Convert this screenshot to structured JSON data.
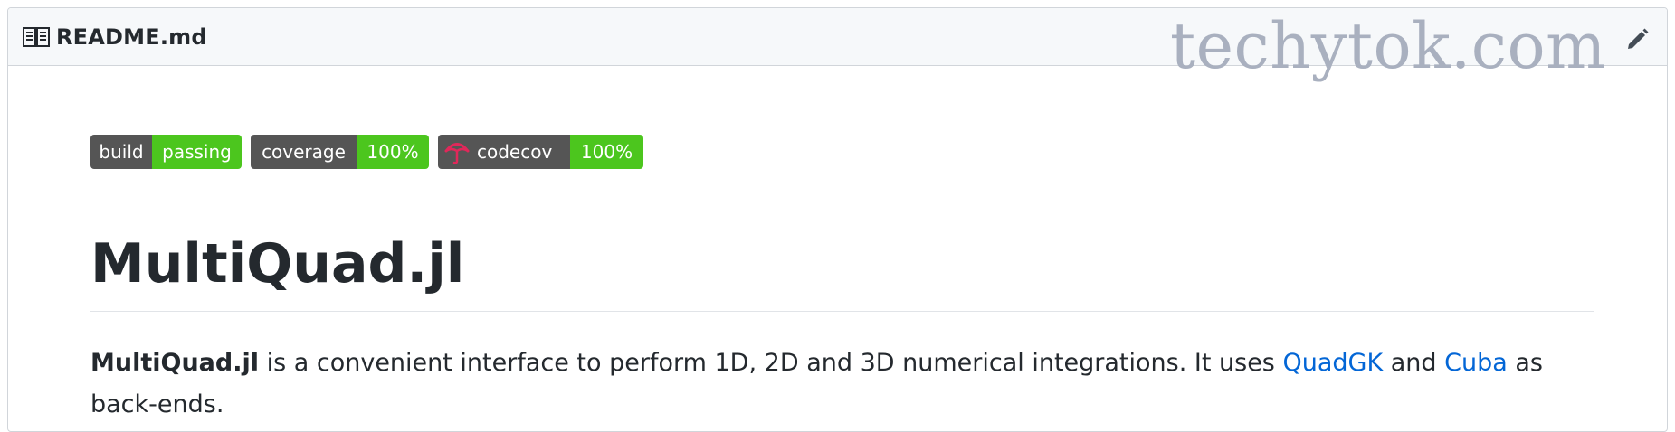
{
  "header": {
    "file_name": "README.md",
    "icons": {
      "file": "book-icon",
      "edit": "pencil-icon"
    }
  },
  "watermark": "techytok.com",
  "badges": [
    {
      "label": "build",
      "value": "passing"
    },
    {
      "label": "coverage",
      "value": "100%"
    },
    {
      "label": "codecov",
      "value": "100%",
      "icon": "codecov-umbrella-icon"
    }
  ],
  "readme": {
    "title": "MultiQuad.jl",
    "intro": {
      "name_bold": "MultiQuad.jl",
      "text_before_links": " is a convenient interface to perform 1D, 2D and 3D numerical integrations. It uses ",
      "link_quadgk": "QuadGK",
      "between_links": " and ",
      "link_cuba": "Cuba",
      "after_links": " as back-ends."
    }
  },
  "colors": {
    "badge_left": "#555555",
    "badge_right": "#4cc61e",
    "link": "#0366d6",
    "watermark": "#a9b0bf",
    "codecov_logo": "#e0285a"
  }
}
